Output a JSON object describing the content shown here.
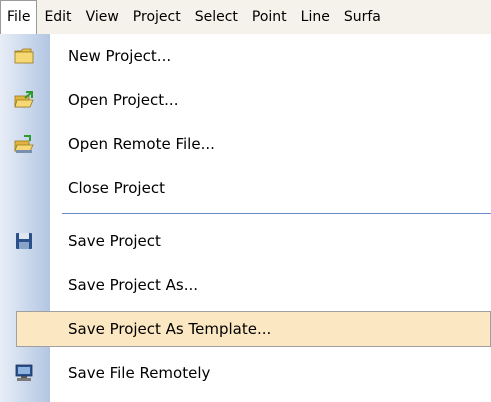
{
  "menubar": {
    "items": [
      "File",
      "Edit",
      "View",
      "Project",
      "Select",
      "Point",
      "Line",
      "Surfa"
    ]
  },
  "file_menu": {
    "new_project": "New Project...",
    "open_project": "Open Project...",
    "open_remote_file": "Open Remote File...",
    "close_project": "Close Project",
    "save_project": "Save Project",
    "save_project_as": "Save Project As...",
    "save_project_as_template": "Save Project As Template...",
    "save_file_remotely": "Save File Remotely"
  },
  "icons": {
    "new_project": "folder-icon",
    "open_project": "open-folder-icon",
    "open_remote_file": "open-remote-folder-icon",
    "save_project": "floppy-disk-icon",
    "save_file_remotely": "computer-icon"
  },
  "colors": {
    "highlight": "#fbe7c1",
    "icon_strip": "#cad8ec",
    "separator": "#6a8cc8"
  }
}
